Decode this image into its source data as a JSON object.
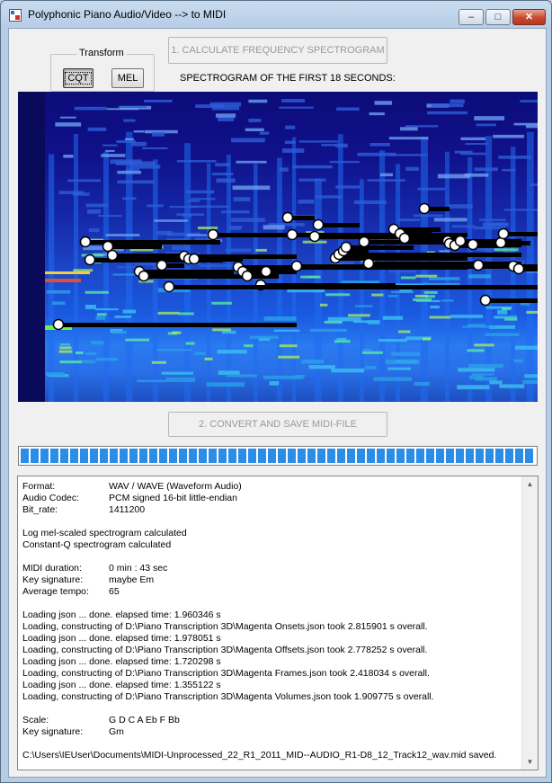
{
  "window": {
    "title": "Polyphonic Piano Audio/Video --> to MIDI",
    "min_glyph": "–",
    "max_glyph": "□",
    "close_glyph": "✕"
  },
  "transform": {
    "label": "Transform",
    "cqt": "CQT",
    "mel": "MEL"
  },
  "buttons": {
    "calculate": "1. CALCULATE FREQUENCY SPECTROGRAM",
    "convert": "2. CONVERT AND SAVE MIDI-FILE"
  },
  "spectrogram": {
    "label": "SPECTROGRAM OF THE FIRST 18 SECONDS:"
  },
  "progress": {
    "value": 1.0
  },
  "log": {
    "format": {
      "k": "Format:",
      "v": "WAV / WAVE (Waveform Audio)"
    },
    "codec": {
      "k": "Audio Codec:",
      "v": "PCM signed 16-bit little-endian"
    },
    "bitrate": {
      "k": "Bit_rate:",
      "v": "1411200"
    },
    "mel": "Log mel-scaled spectrogram calculated",
    "cq": "Constant-Q spectrogram calculated",
    "duration": {
      "k": "MIDI duration:",
      "v": "0 min : 43 sec"
    },
    "key": {
      "k": "Key signature:",
      "v": "maybe Em"
    },
    "tempo": {
      "k": "Average tempo:",
      "v": "65"
    },
    "l1": "Loading json ... done. elapsed time: 1.960346 s",
    "l2": "Loading, constructing of D:\\Piano Transcription 3D\\Magenta Onsets.json took 2.815901 s overall.",
    "l3": "Loading json ... done. elapsed time: 1.978051 s",
    "l4": "Loading, constructing of D:\\Piano Transcription 3D\\Magenta Offsets.json took 2.778252 s overall.",
    "l5": "Loading json ... done. elapsed time: 1.720298 s",
    "l6": "Loading, constructing of D:\\Piano Transcription 3D\\Magenta Frames.json took 2.418034 s overall.",
    "l7": "Loading json ... done. elapsed time: 1.355122 s",
    "l8": "Loading, constructing of D:\\Piano Transcription 3D\\Magenta Volumes.json took 1.909775 s overall.",
    "scale": {
      "k": "Scale:",
      "v": "G D C A Eb F Bb"
    },
    "key2": {
      "k": "Key signature:",
      "v": "Gm"
    },
    "saved": "C:\\Users\\IEUser\\Documents\\MIDI-Unprocessed_22_R1_2011_MID--AUDIO_R1-D8_12_Track12_wav.mid saved."
  }
}
